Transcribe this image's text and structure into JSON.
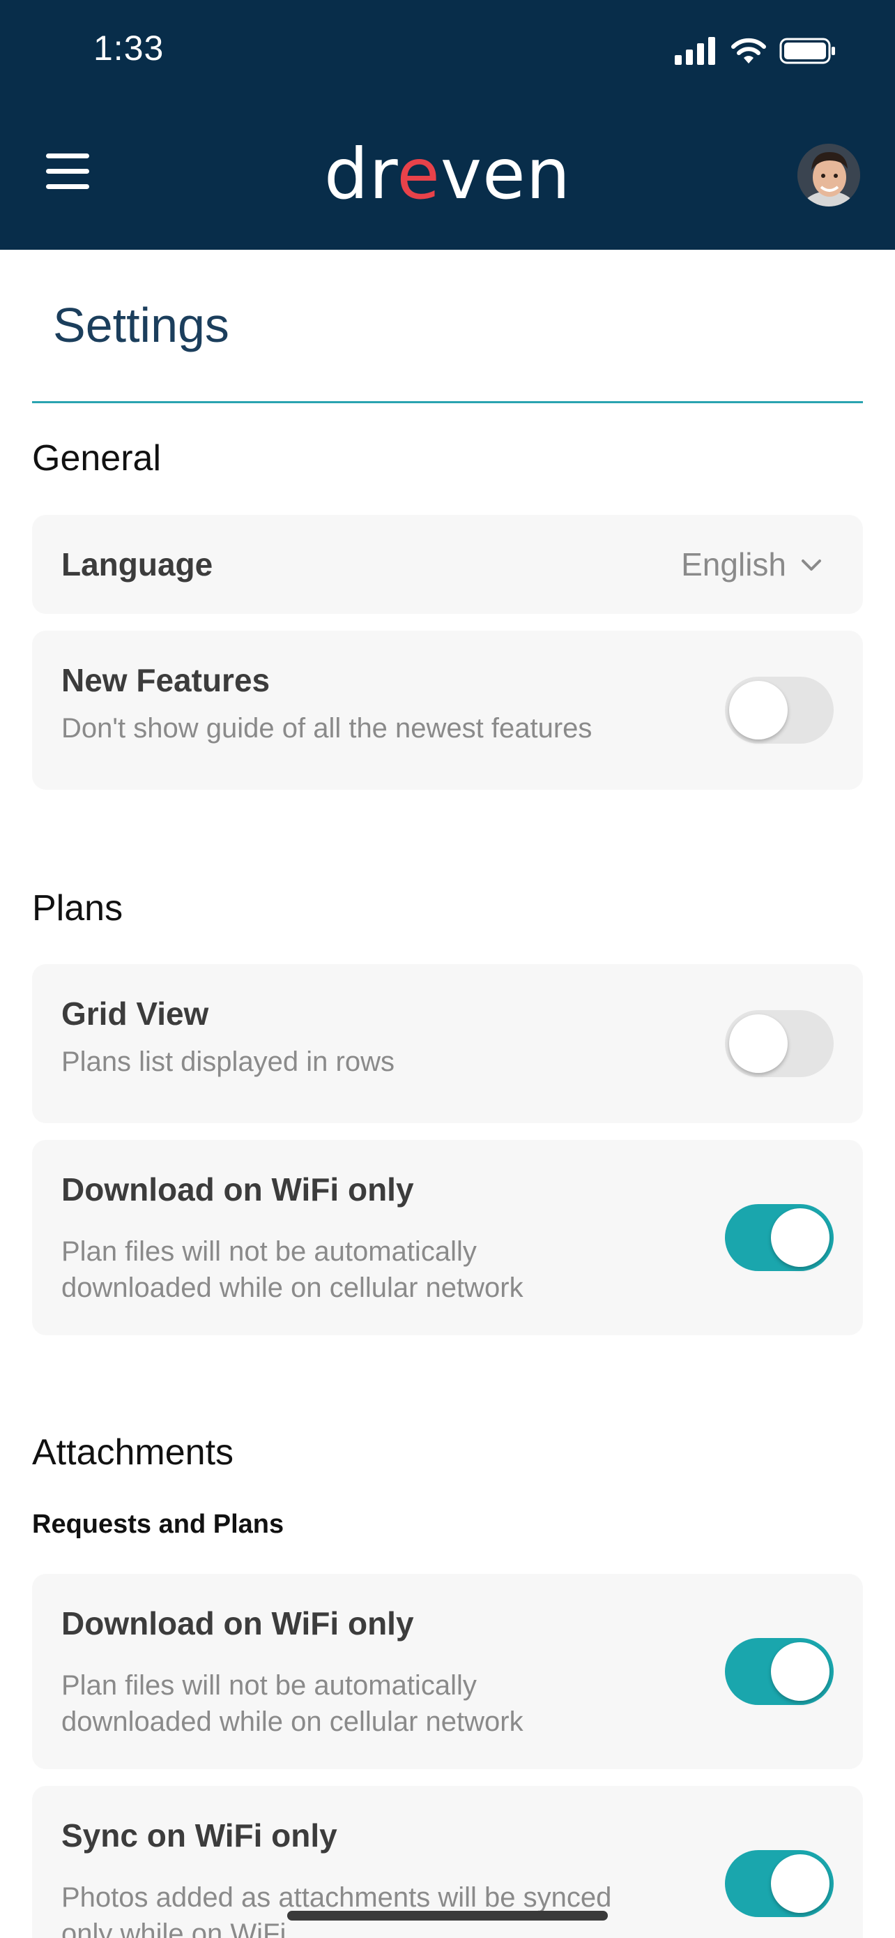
{
  "status_bar": {
    "time": "1:33"
  },
  "header": {
    "logo": {
      "part1": "dr",
      "accent": "e",
      "part2": "ven"
    },
    "menu_icon": "hamburger-menu-icon",
    "avatar_icon": "user-avatar"
  },
  "page": {
    "title": "Settings"
  },
  "colors": {
    "header_bg": "#082d4a",
    "accent": "#1aa6ad",
    "rule": "#2aa3b0",
    "logo_accent": "#e8424a"
  },
  "sections": {
    "general": {
      "heading": "General",
      "language": {
        "label": "Language",
        "value": "English"
      },
      "new_features": {
        "label": "New Features",
        "description": "Don't show guide of all the newest features",
        "enabled": false
      }
    },
    "plans": {
      "heading": "Plans",
      "grid_view": {
        "label": "Grid View",
        "description": "Plans list displayed in rows",
        "enabled": false
      },
      "download_wifi": {
        "label": "Download on WiFi only",
        "description_line1": "Plan files will not be automatically",
        "description_line2": "downloaded while on cellular network",
        "enabled": true
      }
    },
    "attachments": {
      "heading": "Attachments",
      "subheading": "Requests and Plans",
      "download_wifi": {
        "label": "Download on WiFi only",
        "description_line1": "Plan files will not be automatically",
        "description_line2": "downloaded while on cellular network",
        "enabled": true
      },
      "sync_wifi": {
        "label": "Sync on WiFi only",
        "description_line1": "Photos added as attachments will be synced",
        "description_line2": "only while on WiFi",
        "enabled": true
      }
    }
  }
}
